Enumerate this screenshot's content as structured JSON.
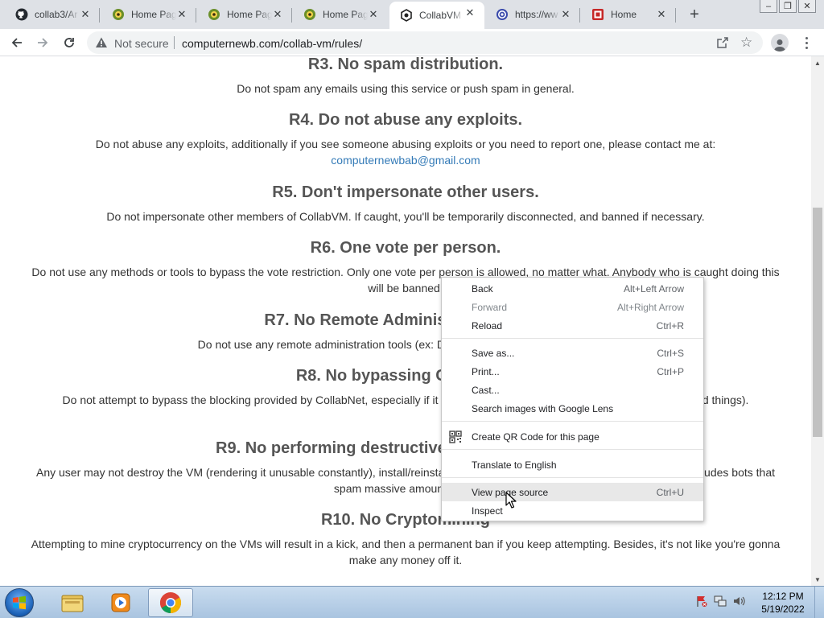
{
  "browser": {
    "tabs": [
      {
        "title": "collab3/Ar",
        "icon": "github-icon"
      },
      {
        "title": "Home Pag",
        "icon": "computernewb-icon"
      },
      {
        "title": "Home Pag",
        "icon": "computernewb-icon"
      },
      {
        "title": "Home Pag",
        "icon": "computernewb-icon"
      },
      {
        "title": "CollabVM",
        "icon": "collabvm-icon",
        "active": true
      },
      {
        "title": "https://ww",
        "icon": "web-icon"
      },
      {
        "title": "Home",
        "icon": "sel-icon"
      }
    ],
    "window_controls": {
      "minimize": "–",
      "restore": "❐",
      "close": "✕"
    }
  },
  "toolbar": {
    "security_label": "Not secure",
    "url": "computernewb.com/collab-vm/rules/"
  },
  "rules": [
    {
      "title": "R3. No spam distribution.",
      "text": "Do not spam any emails using this service or push spam in general."
    },
    {
      "title": "R4. Do not abuse any exploits.",
      "text": "Do not abuse any exploits, additionally if you see someone abusing exploits or you need to report one, please contact me at:",
      "link": "computernewbab@gmail.com"
    },
    {
      "title": "R5. Don't impersonate other users.",
      "text": "Do not impersonate other members of CollabVM. If caught, you'll be temporarily disconnected, and banned if necessary."
    },
    {
      "title": "R6. One vote per person.",
      "text": "Do not use any methods or tools to bypass the vote restriction. Only one vote per person is allowed, no matter what. Anybody who is caught doing this will be banned."
    },
    {
      "title": "R7. No Remote Administration Tools.",
      "text": "Do not use any remote administration tools (ex: DarkComet, NanoCore, Quasar, ...)"
    },
    {
      "title": "R8. No bypassing CollabNet.",
      "text": "Do not attempt to bypass the blocking provided by CollabNet, especially if it is being used to protect the VM from stupid over-used things)."
    },
    {
      "title": "R9. No performing destructive actions constantly.",
      "text": "Any user may not destroy the VM (rendering it unusable constantly), install/reinstall ... and you may not run bots that do such. This includes bots that spam massive amounts of ..."
    },
    {
      "title": "R10. No Cryptomining",
      "text": "Attempting to mine cryptocurrency on the VMs will result in a kick, and then a permanent ban if you keep attempting. Besides, it's not like you're gonna make any money off it."
    }
  ],
  "context_menu": {
    "items": [
      {
        "label": "Back",
        "shortcut": "Alt+Left Arrow"
      },
      {
        "label": "Forward",
        "shortcut": "Alt+Right Arrow",
        "disabled": true
      },
      {
        "label": "Reload",
        "shortcut": "Ctrl+R"
      },
      {
        "label": "Save as...",
        "shortcut": "Ctrl+S"
      },
      {
        "label": "Print...",
        "shortcut": "Ctrl+P"
      },
      {
        "label": "Cast...",
        "shortcut": ""
      },
      {
        "label": "Search images with Google Lens",
        "shortcut": ""
      },
      {
        "label": "Create QR Code for this page",
        "shortcut": "",
        "icon": "qr-code-icon"
      },
      {
        "label": "Translate to English",
        "shortcut": ""
      },
      {
        "label": "View page source",
        "shortcut": "Ctrl+U",
        "hover": true
      },
      {
        "label": "Inspect",
        "shortcut": ""
      }
    ]
  },
  "taskbar": {
    "items": [
      "windows-explorer-icon",
      "media-player-icon",
      "chrome-icon"
    ],
    "clock_time": "12:12 PM",
    "clock_date": "5/19/2022"
  }
}
